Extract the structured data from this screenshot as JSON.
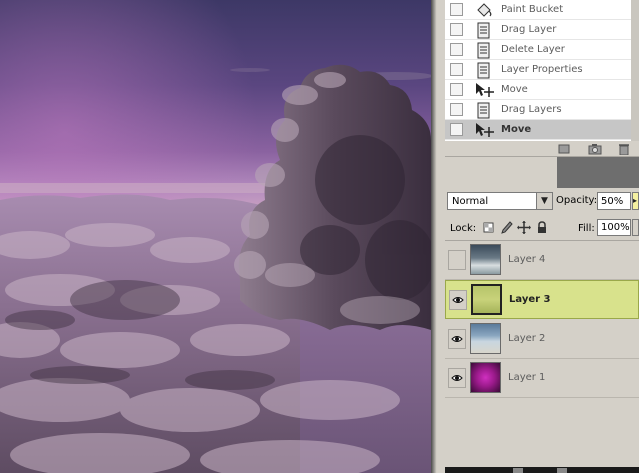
{
  "colors": {
    "panel_bg": "#d4d0c8",
    "active_layer_bg": "#d8e28c",
    "history_active_bg": "#c6c6c6",
    "sky_top": "#3f3a6a",
    "sky_horizon": "#a87fb8"
  },
  "history": {
    "items": [
      {
        "label": "Paint Bucket",
        "icon": "paint-bucket-icon",
        "active": false
      },
      {
        "label": "Drag Layer",
        "icon": "document-icon",
        "active": false
      },
      {
        "label": "Delete Layer",
        "icon": "document-icon",
        "active": false
      },
      {
        "label": "Layer Properties",
        "icon": "document-icon",
        "active": false
      },
      {
        "label": "Move",
        "icon": "move-tool-icon",
        "active": false
      },
      {
        "label": "Drag Layers",
        "icon": "document-icon",
        "active": false
      },
      {
        "label": "Move",
        "icon": "move-tool-icon",
        "active": true
      }
    ],
    "footer_icons": [
      "new-snapshot-icon",
      "camera-icon",
      "trash-icon"
    ]
  },
  "layers_panel": {
    "blend_mode": "Normal",
    "opacity_label": "Opacity:",
    "opacity_value": "50%",
    "lock_label": "Lock:",
    "lock_icons": [
      "lock-transparent-icon",
      "lock-brush-icon",
      "lock-move-icon",
      "lock-all-icon"
    ],
    "fill_label": "Fill:",
    "fill_value": "100%",
    "layers": [
      {
        "name": "Layer 4",
        "visible": false,
        "active": false,
        "thumb": "clouds"
      },
      {
        "name": "Layer 3",
        "visible": true,
        "active": true,
        "thumb": "green"
      },
      {
        "name": "Layer 2",
        "visible": true,
        "active": false,
        "thumb": "sky"
      },
      {
        "name": "Layer 1",
        "visible": true,
        "active": false,
        "thumb": "magenta"
      }
    ]
  }
}
